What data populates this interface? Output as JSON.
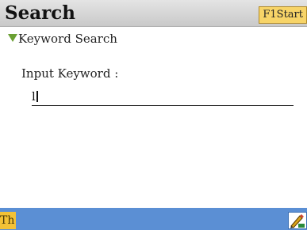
{
  "window": {
    "title": "Search",
    "start_button_label": "F1Start"
  },
  "section": {
    "header": "Keyword Search",
    "toggle_icon": "triangle-down-icon",
    "accent_color": "#6aa033"
  },
  "form": {
    "input_label": "Input Keyword :",
    "input_value": "l"
  },
  "status_bar": {
    "input_mode": "Th",
    "handwriting_icon": "pencil-icon",
    "bar_color": "#5b8fd4"
  }
}
